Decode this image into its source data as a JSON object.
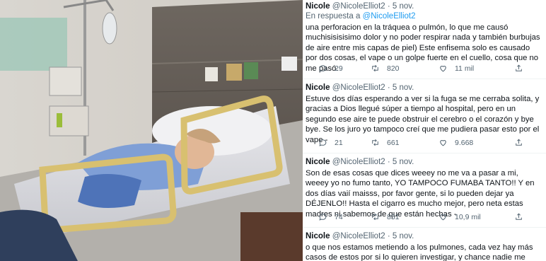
{
  "tweets": [
    {
      "name": "Nicole",
      "handle": "@NicoleElliot2",
      "time": "5 nov.",
      "replying_prefix": "En respuesta a",
      "replying_to": "@NicoleElliot2",
      "text": "una perforacion en la tráquea o pulmón, lo que me causó muchisisisisimo dolor y no poder respirar nada y también burbujas de aire entre mis capas de piel) Este enfisema solo es causado por dos cosas, el vape o un golpe fuerte en el cuello, cosa que no me pasó.",
      "replies": "29",
      "retweets": "820",
      "likes": "11 mil"
    },
    {
      "name": "Nicole",
      "handle": "@NicoleElliot2",
      "time": "5 nov.",
      "text": "Estuve dos días esperando a ver si la fuga se me cerraba solita, y gracias a Dios llegué súper a tiempo al hospital, pero en un segundo ese aire te puede obstruir el cerebro o el corazón y bye bye. Se los juro yo tampoco creí que me pudiera pasar esto por el vape -",
      "replies": "21",
      "retweets": "661",
      "likes": "9.668"
    },
    {
      "name": "Nicole",
      "handle": "@NicoleElliot2",
      "time": "5 nov.",
      "text": "Son de esas cosas que dices weeey no me va a pasar a mi, weeey yo no fumo tanto, YO TAMPOCO FUMABA TANTO!! Y en dos días vaií maisss, por favor gente, si lo pueden dejar ya DÉJENLO!! Hasta el cigarro es mucho mejor, pero neta estas madres ni sabemos de que están hechas -",
      "replies": "74",
      "retweets": "851",
      "likes": "10,9 mil"
    },
    {
      "name": "Nicole",
      "handle": "@NicoleElliot2",
      "time": "5 nov.",
      "text": "o que nos estamos metiendo a los pulmones, cada vez hay más casos de estos por si lo quieren investigar, y chance nadie me pela pero al menos"
    }
  ],
  "icons": [
    "reply-icon",
    "retweet-icon",
    "like-icon",
    "share-icon"
  ],
  "colors": {
    "link": "#1d9bf0",
    "muted": "#536471",
    "text": "#0f1419"
  }
}
